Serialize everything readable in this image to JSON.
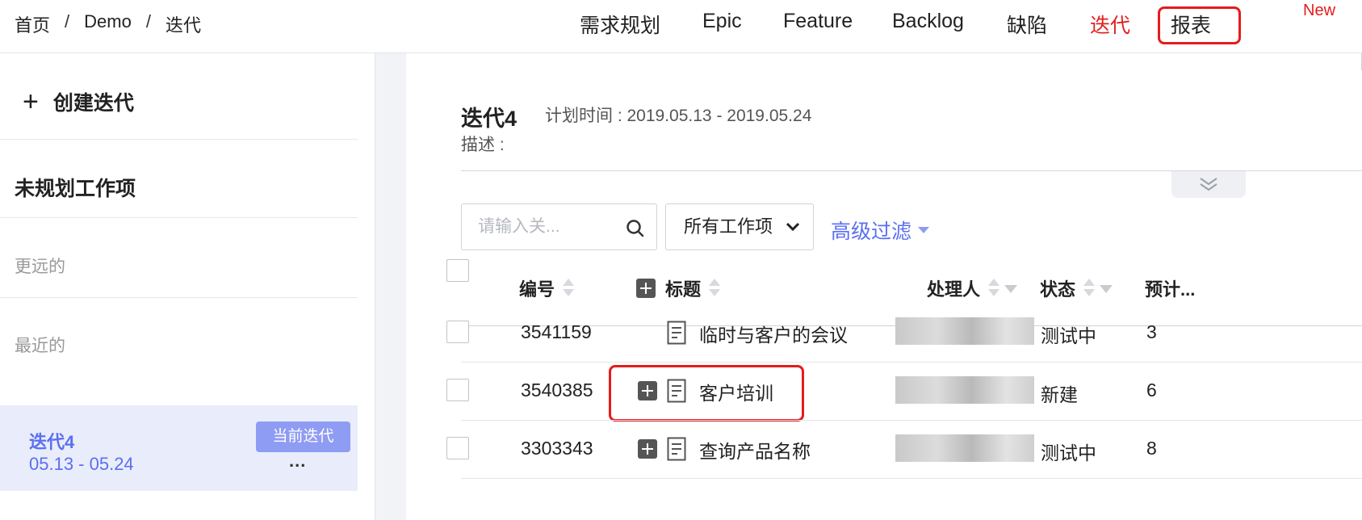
{
  "breadcrumb": [
    "首页",
    "Demo",
    "迭代"
  ],
  "nav": {
    "items": [
      {
        "label": "需求规划"
      },
      {
        "label": "Epic"
      },
      {
        "label": "Feature"
      },
      {
        "label": "Backlog"
      },
      {
        "label": "缺陷"
      },
      {
        "label": "迭代",
        "active": true
      },
      {
        "label": "报表"
      }
    ],
    "new_badge": "New"
  },
  "sidebar": {
    "create_label": "创建迭代",
    "unplanned_heading": "未规划工作项",
    "groups": [
      "更远的",
      "最近的"
    ],
    "current_iteration": {
      "name": "迭代4",
      "dates": "05.13 - 05.24",
      "badge": "当前迭代",
      "more": "..."
    }
  },
  "main": {
    "iteration_title": "迭代4",
    "plan_time": "计划时间 : 2019.05.13 - 2019.05.24",
    "description_label": "描述 :",
    "search_placeholder": "请输入关...",
    "filter_value": "所有工作项",
    "advanced_filter": "高级过滤"
  },
  "table": {
    "columns": {
      "number": "编号",
      "title": "标题",
      "assignee": "处理人",
      "status": "状态",
      "estimate": "预计..."
    },
    "rows": [
      {
        "number": "3541159",
        "title": "临时与客户的会议",
        "status": "测试中",
        "estimate": "3",
        "expandable": false
      },
      {
        "number": "3540385",
        "title": "客户培训",
        "status": "新建",
        "estimate": "6",
        "expandable": true
      },
      {
        "number": "3303343",
        "title": "查询产品名称",
        "status": "测试中",
        "estimate": "8",
        "expandable": true
      }
    ]
  },
  "colors": {
    "accent": "#5b6ff0",
    "active_nav": "#e02020",
    "highlight_border": "#e41c1c",
    "badge_bg": "#8f9cf3"
  }
}
